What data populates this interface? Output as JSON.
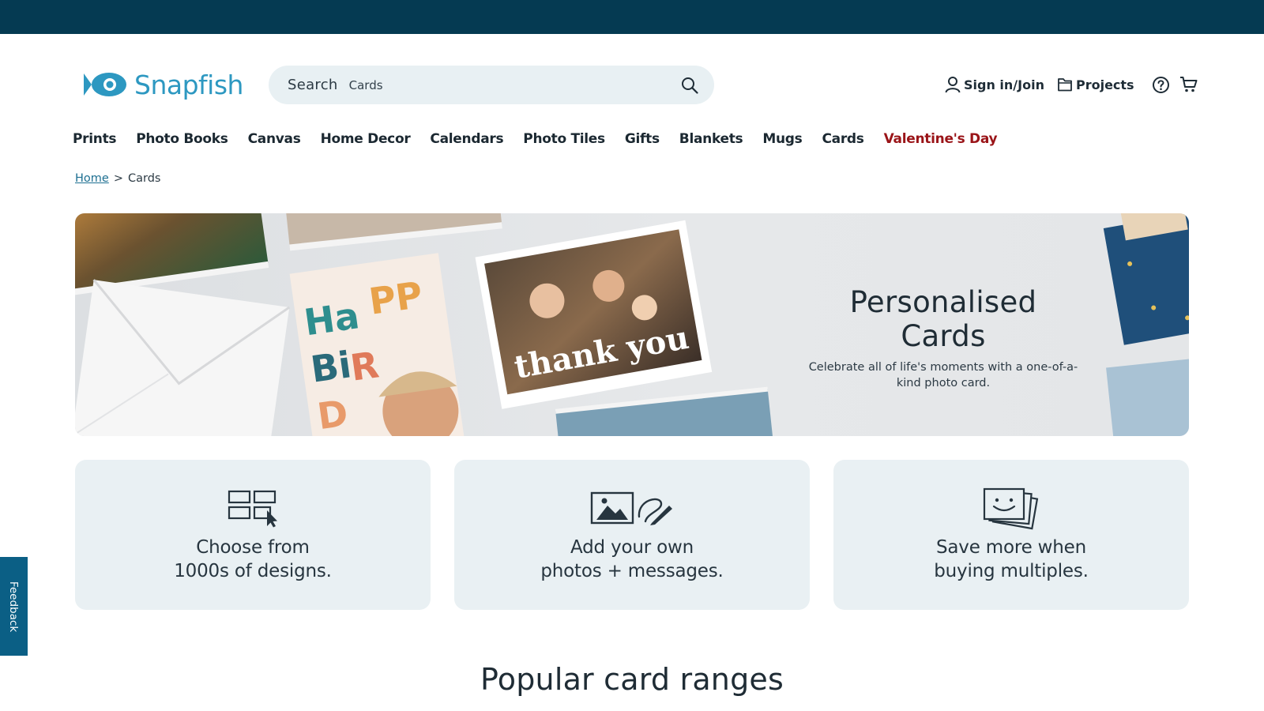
{
  "brand": {
    "name": "Snapfish",
    "accent": "#2d98c1",
    "topbar_color": "#053a52"
  },
  "search": {
    "label": "Search",
    "value": "Cards",
    "icon": "search-icon"
  },
  "account": {
    "sign_in": "Sign in/Join",
    "projects": "Projects",
    "help_icon": "help-icon",
    "cart_icon": "cart-icon"
  },
  "nav": {
    "items": [
      {
        "label": "Prints"
      },
      {
        "label": "Photo Books"
      },
      {
        "label": "Canvas"
      },
      {
        "label": "Home Decor"
      },
      {
        "label": "Calendars"
      },
      {
        "label": "Photo Tiles"
      },
      {
        "label": "Gifts"
      },
      {
        "label": "Blankets"
      },
      {
        "label": "Mugs"
      },
      {
        "label": "Cards"
      },
      {
        "label": "Valentine's Day",
        "color": "#9a1418"
      }
    ]
  },
  "breadcrumb": {
    "home": "Home",
    "separator": ">",
    "current": "Cards"
  },
  "hero": {
    "title": "Personalised Cards",
    "subtitle": "Celebrate all of life's moments with a one-of-a-kind photo card."
  },
  "features": [
    {
      "text": "Choose from\n1000s of designs.",
      "icon": "design-grid-icon"
    },
    {
      "text": "Add your own\nphotos + messages.",
      "icon": "photo-edit-icon"
    },
    {
      "text": "Save more when\nbuying multiples.",
      "icon": "stacked-cards-icon"
    }
  ],
  "feedback": {
    "label": "Feedback"
  },
  "sections": {
    "popular_title": "Popular card ranges"
  }
}
